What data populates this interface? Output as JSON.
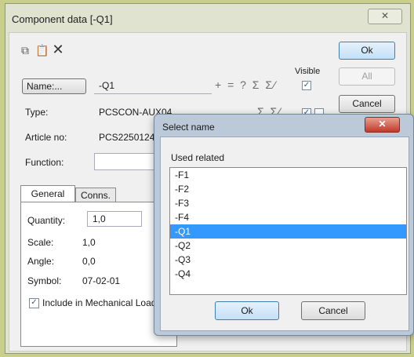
{
  "main": {
    "title": "Component data [-Q1]",
    "close_label": "X",
    "buttons": {
      "ok": "Ok",
      "all": "All",
      "cancel": "Cancel"
    },
    "visible_label": "Visible",
    "name_button": "Name:...",
    "name_value": "-Q1",
    "name_symbols": "+ = ? Σ Σ⁄",
    "type_label": "Type:",
    "type_value": "PCSCON-AUX04",
    "type_symbols": "Σ Σ⁄",
    "article_label": "Article no:",
    "article_value": "PCS2250124",
    "function_label": "Function:",
    "tabs": [
      "General",
      "Conns."
    ],
    "general": {
      "quantity_label": "Quantity:",
      "quantity_value": "1,0",
      "scale_label": "Scale:",
      "scale_value": "1,0",
      "angle_label": "Angle:",
      "angle_value": "0,0",
      "symbol_label": "Symbol:",
      "symbol_value": "07-02-01",
      "include_label": "Include in Mechanical Load"
    }
  },
  "select_dialog": {
    "title": "Select name",
    "close_label": "x",
    "group_label": "Used related",
    "items": [
      "-F1",
      "-F2",
      "-F3",
      "-F4",
      "-Q1",
      "-Q2",
      "-Q3",
      "-Q4"
    ],
    "selected": "-Q1",
    "ok": "Ok",
    "cancel": "Cancel"
  }
}
